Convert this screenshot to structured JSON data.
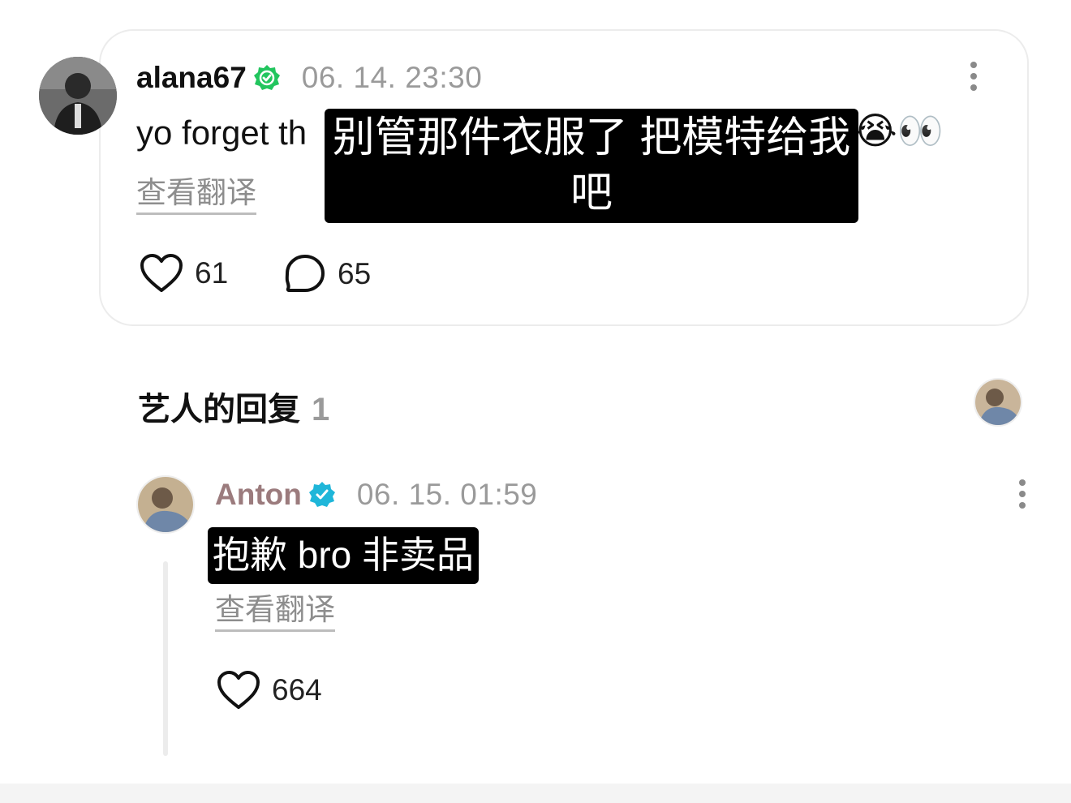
{
  "comment": {
    "username": "alana67",
    "timestamp": "06. 14. 23:30",
    "text": "yo forget th",
    "emoji_end": "😭👀",
    "translation_overlay": "别管那件衣服了 把模特给我吧",
    "view_translation": "查看翻译",
    "likes": "61",
    "replies": "65"
  },
  "artist_replies": {
    "title": "艺人的回复",
    "count": "1"
  },
  "reply": {
    "username": "Anton",
    "timestamp": "06. 15. 01:59",
    "text": "抱歉 bro 非卖品",
    "view_translation": "查看翻译",
    "likes": "664"
  },
  "colors": {
    "verified_green": "#22c55e",
    "verified_blue": "#1fb6d9",
    "artist_name": "#9b7b7d",
    "muted": "#9a9a9a"
  },
  "icons": [
    "verified-check-icon",
    "more-options-icon",
    "heart-icon",
    "reply-bubble-icon"
  ]
}
